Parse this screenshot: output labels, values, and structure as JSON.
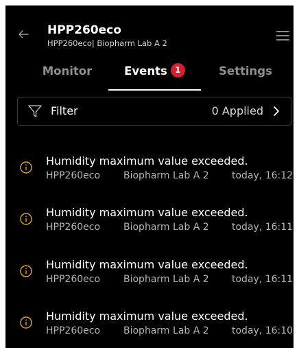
{
  "header": {
    "title": "HPP260eco",
    "subtitle": "HPP260eco| Biopharm Lab A 2"
  },
  "tabs": [
    {
      "label": "Monitor",
      "active": false
    },
    {
      "label": "Events",
      "active": true,
      "badge": "1"
    },
    {
      "label": "Settings",
      "active": false
    }
  ],
  "filter": {
    "label": "Filter",
    "applied": "0 Applied"
  },
  "events": [
    {
      "message": "Humidity maximum value exceeded.",
      "device": "HPP260eco",
      "location": "Biopharm Lab A 2",
      "time": "today, 16:12"
    },
    {
      "message": "Humidity maximum value exceeded.",
      "device": "HPP260eco",
      "location": "Biopharm Lab A 2",
      "time": "today, 16:11"
    },
    {
      "message": "Humidity maximum value exceeded.",
      "device": "HPP260eco",
      "location": "Biopharm Lab A 2",
      "time": "today, 16:11"
    },
    {
      "message": "Humidity maximum value exceeded.",
      "device": "HPP260eco",
      "location": "Biopharm Lab A 2",
      "time": "today, 16:10"
    }
  ],
  "colors": {
    "background": "#000000",
    "accent_warning": "#e8a317",
    "badge": "#d3202f"
  },
  "icons": {
    "back": "arrow-left-icon",
    "menu": "hamburger-menu-icon",
    "filter": "funnel-icon",
    "chevron": "chevron-right-icon",
    "event": "info-circle-icon"
  }
}
